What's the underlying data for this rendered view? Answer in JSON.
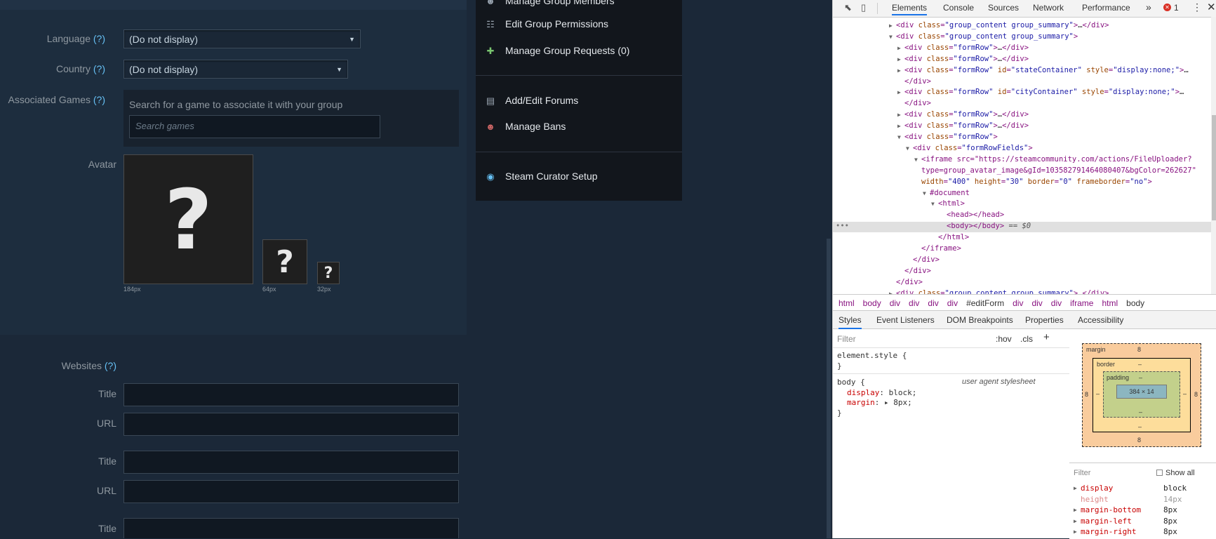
{
  "form": {
    "language_label": "Language",
    "country_label": "Country",
    "games_label": "Associated Games",
    "help_mark": "(?)",
    "language_value": "(Do not display)",
    "country_value": "(Do not display)",
    "games_hint": "Search for a game to associate it with your group",
    "games_placeholder": "Search games",
    "avatar_label": "Avatar",
    "avatar_glyph": "?",
    "avatar_sizes": [
      "184px",
      "64px",
      "32px"
    ],
    "websites_label": "Websites",
    "title_label": "Title",
    "url_label": "URL"
  },
  "menu": {
    "items": [
      {
        "label": "Manage Group Members",
        "icon": "members-icon"
      },
      {
        "label": "Edit Group Permissions",
        "icon": "permissions-icon"
      },
      {
        "label": "Manage Group Requests (0)",
        "icon": "requests-icon"
      },
      {
        "label": "Add/Edit Forums",
        "icon": "forums-icon"
      },
      {
        "label": "Manage Bans",
        "icon": "bans-icon"
      },
      {
        "label": "Steam Curator Setup",
        "icon": "curator-icon"
      }
    ]
  },
  "devtools": {
    "tabs": [
      "Elements",
      "Console",
      "Sources",
      "Network",
      "Performance"
    ],
    "more": "»",
    "error_count": "1",
    "dom_lines": [
      {
        "indent": 0,
        "arrow": "▶",
        "text": "<div class=\"group_content group_summary\">…</div>"
      },
      {
        "indent": 0,
        "arrow": "▼",
        "text": "<div class=\"group_content group_summary\">"
      },
      {
        "indent": 1,
        "arrow": "▶",
        "text": "<div class=\"formRow\">…</div>"
      },
      {
        "indent": 1,
        "arrow": "▶",
        "text": "<div class=\"formRow\">…</div>"
      },
      {
        "indent": 1,
        "arrow": "▶",
        "text": "<div class=\"formRow\" id=\"stateContainer\" style=\"display:none;\">…"
      },
      {
        "indent": 1,
        "arrow": "",
        "text": "</div>"
      },
      {
        "indent": 1,
        "arrow": "▶",
        "text": "<div class=\"formRow\" id=\"cityContainer\" style=\"display:none;\">…"
      },
      {
        "indent": 1,
        "arrow": "",
        "text": "</div>"
      },
      {
        "indent": 1,
        "arrow": "▶",
        "text": "<div class=\"formRow\">…</div>"
      },
      {
        "indent": 1,
        "arrow": "▶",
        "text": "<div class=\"formRow\">…</div>"
      },
      {
        "indent": 1,
        "arrow": "▼",
        "text": "<div class=\"formRow\">"
      },
      {
        "indent": 2,
        "arrow": "▼",
        "text": "<div class=\"formRowFields\">"
      },
      {
        "indent": 3,
        "arrow": "▼",
        "text": "<iframe src=\"https://steamcommunity.com/actions/FileUploader?"
      },
      {
        "indent": 3,
        "arrow": "",
        "text": "type=group_avatar_image&gId=103582791464080407&bgColor=262627\""
      },
      {
        "indent": 3,
        "arrow": "",
        "text": "width=\"400\" height=\"30\" border=\"0\" frameborder=\"no\">"
      },
      {
        "indent": 4,
        "arrow": "▼",
        "text": "#document"
      },
      {
        "indent": 5,
        "arrow": "▼",
        "text": "<html>"
      },
      {
        "indent": 6,
        "arrow": "",
        "text": "<head></head>"
      },
      {
        "indent": 6,
        "arrow": "",
        "text": "<body></body> == $0"
      },
      {
        "indent": 5,
        "arrow": "",
        "text": "</html>"
      },
      {
        "indent": 3,
        "arrow": "",
        "text": "</iframe>"
      },
      {
        "indent": 2,
        "arrow": "",
        "text": "</div>"
      },
      {
        "indent": 1,
        "arrow": "",
        "text": "</div>"
      },
      {
        "indent": 0,
        "arrow": "",
        "text": "</div>"
      },
      {
        "indent": 0,
        "arrow": "▶",
        "text": "<div class=\"group_content group_summary\">…</div>"
      }
    ],
    "breadcrumbs": [
      "html",
      "body",
      "div",
      "div",
      "div",
      "div",
      "#editForm",
      "div",
      "div",
      "div",
      "iframe",
      "html",
      "body"
    ],
    "subtabs": [
      "Styles",
      "Event Listeners",
      "DOM Breakpoints",
      "Properties",
      "Accessibility"
    ],
    "filter_placeholder": "Filter",
    "hov": ":hov",
    "cls": ".cls",
    "plus": "+",
    "element_style": "element.style {",
    "close_brace": "}",
    "body_rule": "body {",
    "ua_label": "user agent stylesheet",
    "decl_display_prop": "display",
    "decl_display_val": "block;",
    "decl_margin_prop": "margin",
    "decl_margin_val": "8px;",
    "boxmodel": {
      "margin_label": "margin",
      "margin_value": "8",
      "border_label": "border",
      "border_value": "–",
      "padding_label": "padding",
      "padding_value": "–",
      "content": "384 × 14",
      "side_margin": "8",
      "side_dash": "–"
    },
    "computed_filter": "Filter",
    "show_all": "Show all",
    "computed": [
      {
        "prop": "display",
        "value": "block",
        "inherited": false
      },
      {
        "prop": "height",
        "value": "14px",
        "inherited": true
      },
      {
        "prop": "margin-bottom",
        "value": "8px",
        "inherited": false
      },
      {
        "prop": "margin-left",
        "value": "8px",
        "inherited": false
      },
      {
        "prop": "margin-right",
        "value": "8px",
        "inherited": false
      }
    ]
  },
  "colors": {
    "steam_bg": "#1b2838",
    "accent": "#66c0f4",
    "devtools_active": "#1a73e8"
  }
}
